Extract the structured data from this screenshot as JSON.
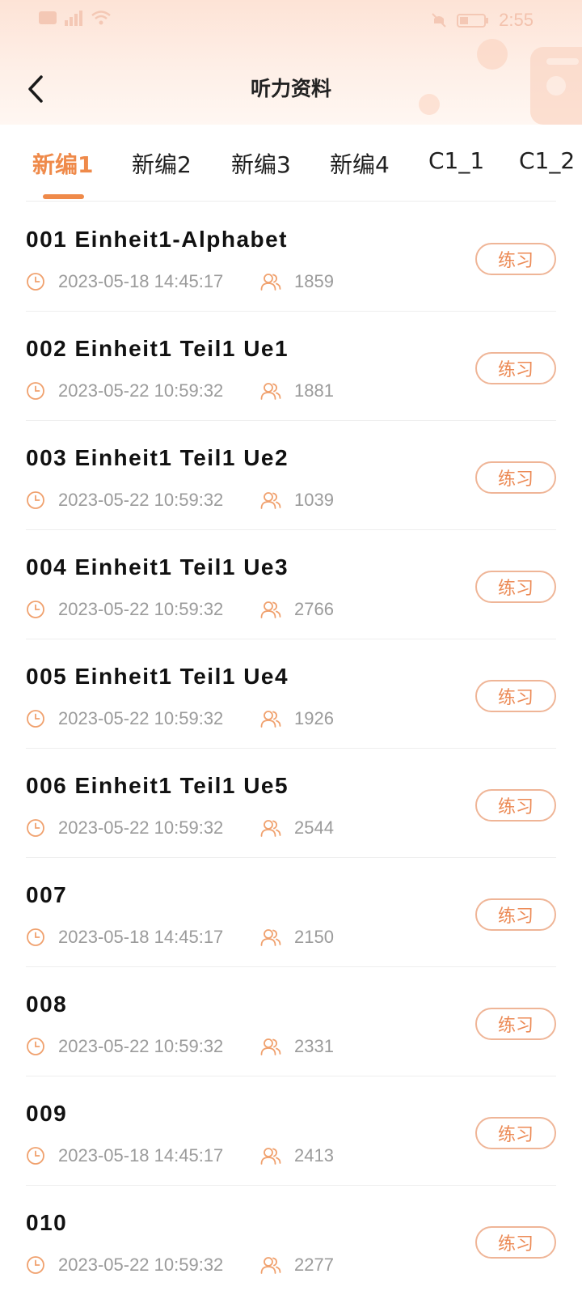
{
  "status_bar": {
    "time": "2:55"
  },
  "header": {
    "title": "听力资料"
  },
  "tabs": [
    {
      "label": "新编1",
      "active": true
    },
    {
      "label": "新编2",
      "active": false
    },
    {
      "label": "新编3",
      "active": false
    },
    {
      "label": "新编4",
      "active": false
    },
    {
      "label": "C1_1",
      "active": false
    },
    {
      "label": "C1_2",
      "active": false
    }
  ],
  "items": [
    {
      "title": "001 Einheit1-Alphabet",
      "date": "2023-05-18 14:45:17",
      "count": "1859",
      "button": "练习"
    },
    {
      "title": "002 Einheit1 Teil1 Ue1",
      "date": "2023-05-22 10:59:32",
      "count": "1881",
      "button": "练习"
    },
    {
      "title": "003 Einheit1 Teil1 Ue2",
      "date": "2023-05-22 10:59:32",
      "count": "1039",
      "button": "练习"
    },
    {
      "title": "004 Einheit1 Teil1 Ue3",
      "date": "2023-05-22 10:59:32",
      "count": "2766",
      "button": "练习"
    },
    {
      "title": "005 Einheit1 Teil1 Ue4",
      "date": "2023-05-22 10:59:32",
      "count": "1926",
      "button": "练习"
    },
    {
      "title": "006 Einheit1 Teil1 Ue5",
      "date": "2023-05-22 10:59:32",
      "count": "2544",
      "button": "练习"
    },
    {
      "title": "007",
      "date": "2023-05-18 14:45:17",
      "count": "2150",
      "button": "练习"
    },
    {
      "title": "008",
      "date": "2023-05-22 10:59:32",
      "count": "2331",
      "button": "练习"
    },
    {
      "title": "009",
      "date": "2023-05-18 14:45:17",
      "count": "2413",
      "button": "练习"
    },
    {
      "title": "010",
      "date": "2023-05-22 10:59:32",
      "count": "2277",
      "button": "练习"
    }
  ],
  "colors": {
    "accent": "#ef8a4a",
    "meta_text": "#9b9b9b",
    "button_border": "#efb597"
  },
  "icons": {
    "back": "chevron-left-icon",
    "time": "clock-icon",
    "learners": "users-icon"
  }
}
